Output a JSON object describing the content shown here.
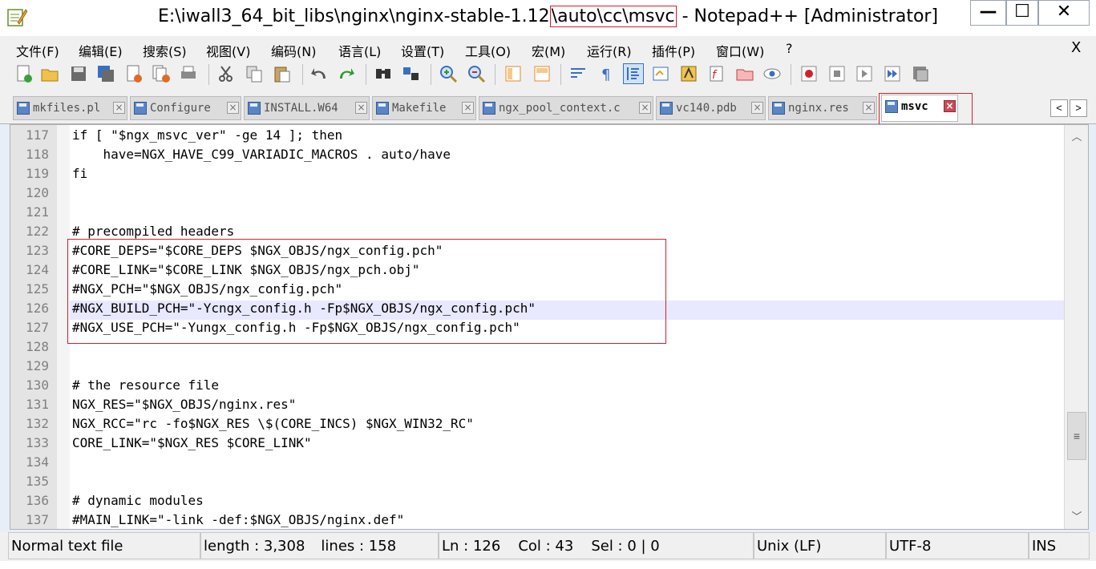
{
  "window": {
    "title_prefix": "E:\\iwall3_64_bit_libs\\nginx\\nginx-stable-1.12",
    "title_highlight": "\\auto\\cc\\msvc",
    "title_suffix": " - Notepad++ [Administrator]",
    "minimize": "—",
    "maximize": "☐",
    "close": "✕"
  },
  "menu": {
    "items": [
      "文件(F)",
      "编辑(E)",
      "搜索(S)",
      "视图(V)",
      "编码(N)",
      "语言(L)",
      "设置(T)",
      "工具(O)",
      "宏(M)",
      "运行(R)",
      "插件(P)",
      "窗口(W)",
      "?"
    ],
    "close": "X"
  },
  "toolbar": {
    "icons": [
      "new-file-icon",
      "open-file-icon",
      "save-icon",
      "save-all-icon",
      "close-icon",
      "close-all-icon",
      "print-icon",
      "cut-icon",
      "copy-icon",
      "paste-icon",
      "undo-icon",
      "redo-icon",
      "find-icon",
      "replace-icon",
      "zoom-in-icon",
      "zoom-out-icon",
      "sync-vertical-icon",
      "sync-horizontal-icon",
      "word-wrap-icon",
      "show-all-chars-icon",
      "indent-guide-icon",
      "doc-map-icon",
      "function-list-icon",
      "folder-workspace-icon",
      "doc-switcher-icon",
      "monitoring-icon",
      "record-macro-icon",
      "stop-record-icon",
      "play-macro-icon",
      "run-macro-multiple-icon",
      "save-macro-icon"
    ]
  },
  "tabs": [
    {
      "label": "mkfiles.pl",
      "active": false
    },
    {
      "label": "Configure",
      "active": false
    },
    {
      "label": "INSTALL.W64",
      "active": false
    },
    {
      "label": "Makefile",
      "active": false
    },
    {
      "label": "ngx_pool_context.c",
      "active": false
    },
    {
      "label": "vc140.pdb",
      "active": false
    },
    {
      "label": "nginx.res",
      "active": false
    },
    {
      "label": "msvc",
      "active": true
    }
  ],
  "tab_scroll": {
    "left": "<",
    "right": ">"
  },
  "editor": {
    "current_line": 126,
    "lines": [
      {
        "num": "117",
        "text": "if [ \"$ngx_msvc_ver\" -ge 14 ]; then"
      },
      {
        "num": "118",
        "text": "    have=NGX_HAVE_C99_VARIADIC_MACROS . auto/have"
      },
      {
        "num": "119",
        "text": "fi"
      },
      {
        "num": "120",
        "text": ""
      },
      {
        "num": "121",
        "text": ""
      },
      {
        "num": "122",
        "text": "# precompiled headers"
      },
      {
        "num": "123",
        "text": "#CORE_DEPS=\"$CORE_DEPS $NGX_OBJS/ngx_config.pch\""
      },
      {
        "num": "124",
        "text": "#CORE_LINK=\"$CORE_LINK $NGX_OBJS/ngx_pch.obj\""
      },
      {
        "num": "125",
        "text": "#NGX_PCH=\"$NGX_OBJS/ngx_config.pch\""
      },
      {
        "num": "126",
        "text": "#NGX_BUILD_PCH=\"-Ycngx_config.h -Fp$NGX_OBJS/ngx_config.pch\""
      },
      {
        "num": "127",
        "text": "#NGX_USE_PCH=\"-Yungx_config.h -Fp$NGX_OBJS/ngx_config.pch\""
      },
      {
        "num": "128",
        "text": ""
      },
      {
        "num": "129",
        "text": ""
      },
      {
        "num": "130",
        "text": "# the resource file"
      },
      {
        "num": "131",
        "text": "NGX_RES=\"$NGX_OBJS/nginx.res\""
      },
      {
        "num": "132",
        "text": "NGX_RCC=\"rc -fo$NGX_RES \\$(CORE_INCS) $NGX_WIN32_RC\""
      },
      {
        "num": "133",
        "text": "CORE_LINK=\"$NGX_RES $CORE_LINK\""
      },
      {
        "num": "134",
        "text": ""
      },
      {
        "num": "135",
        "text": ""
      },
      {
        "num": "136",
        "text": "# dynamic modules"
      },
      {
        "num": "137",
        "text": "#MAIN_LINK=\"-link -def:$NGX_OBJS/nginx.def\""
      }
    ]
  },
  "scrollbar": {
    "up": "︿",
    "down": "﹀",
    "thumb": "≡"
  },
  "status": {
    "file_type": "Normal text file",
    "length": "length : 3,308",
    "lines": "lines : 158",
    "ln": "Ln : 126",
    "col": "Col : 43",
    "sel": "Sel : 0 | 0",
    "eol": "Unix (LF)",
    "encoding": "UTF-8",
    "mode": "INS"
  }
}
